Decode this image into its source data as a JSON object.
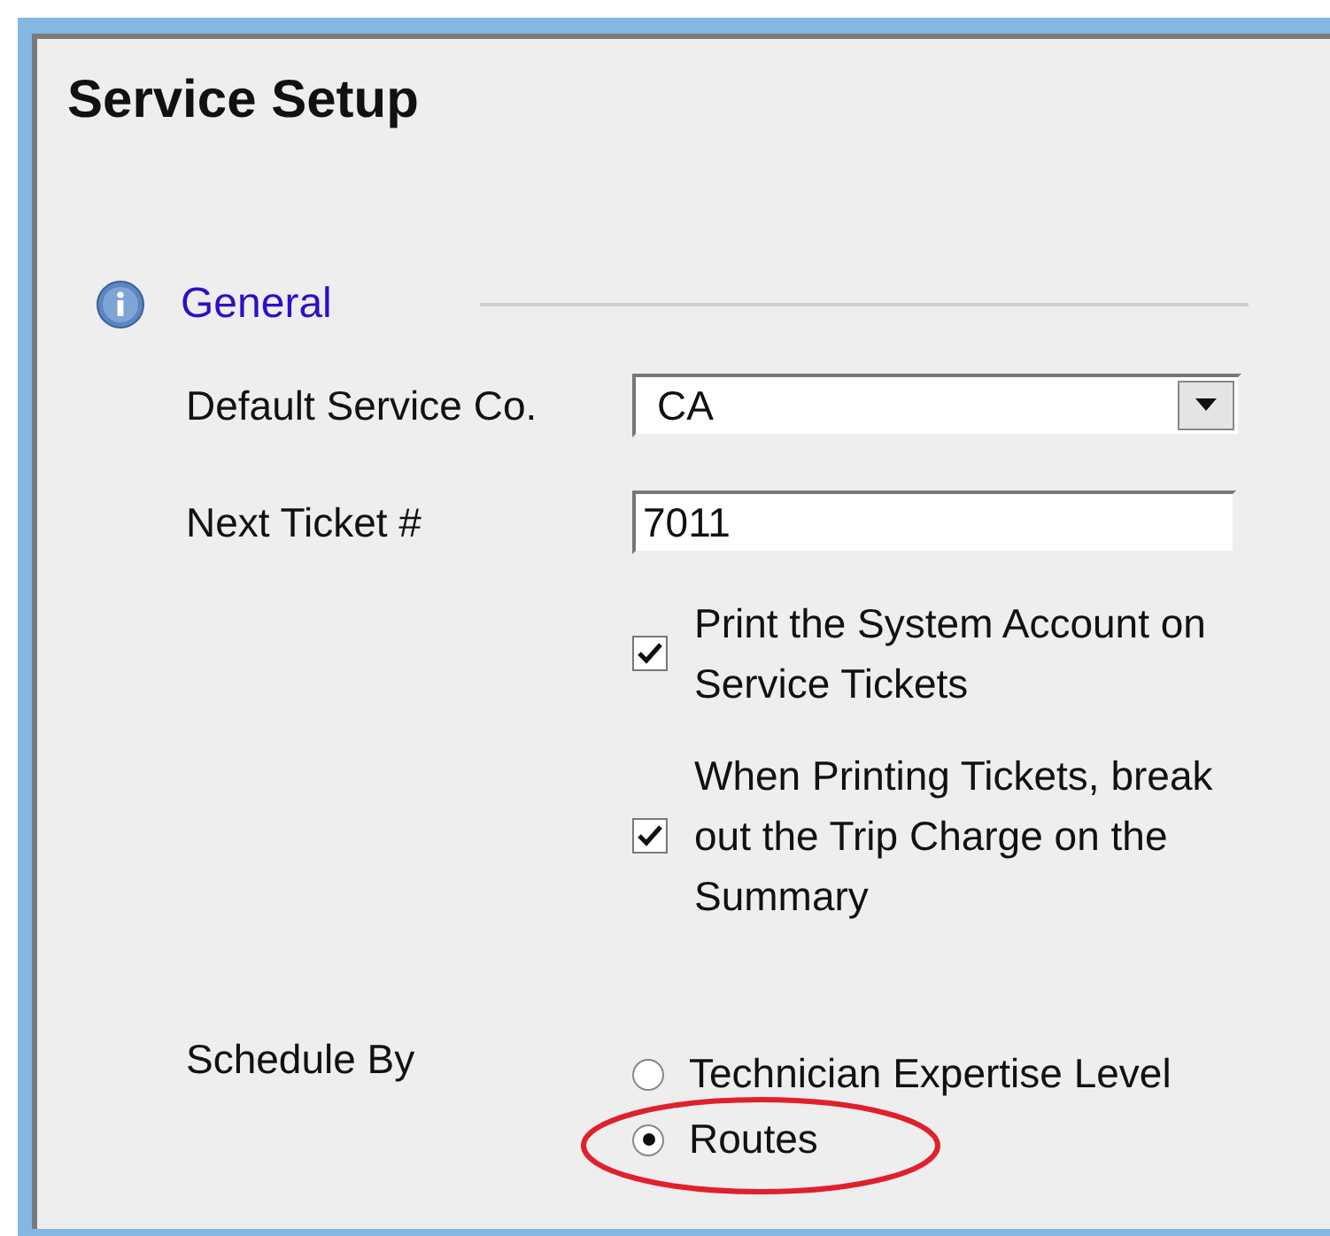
{
  "window": {
    "title": "Service Setup"
  },
  "section": {
    "title": "General"
  },
  "fields": [
    {
      "kind": "dropdown",
      "label": "Default Service Co.",
      "value": "CA"
    },
    {
      "kind": "text",
      "label": "Next Ticket #",
      "value": "7011"
    }
  ],
  "checkboxes": [
    {
      "label": "Print the System Account on Service Tickets",
      "checked": true
    },
    {
      "label": "When Printing Tickets, break out the Trip Charge on the Summary",
      "checked": true
    }
  ],
  "schedule": {
    "label": "Schedule By",
    "options": [
      {
        "label": "Technician Expertise Level",
        "selected": false,
        "highlighted": false
      },
      {
        "label": "Routes",
        "selected": true,
        "highlighted": true
      }
    ]
  }
}
